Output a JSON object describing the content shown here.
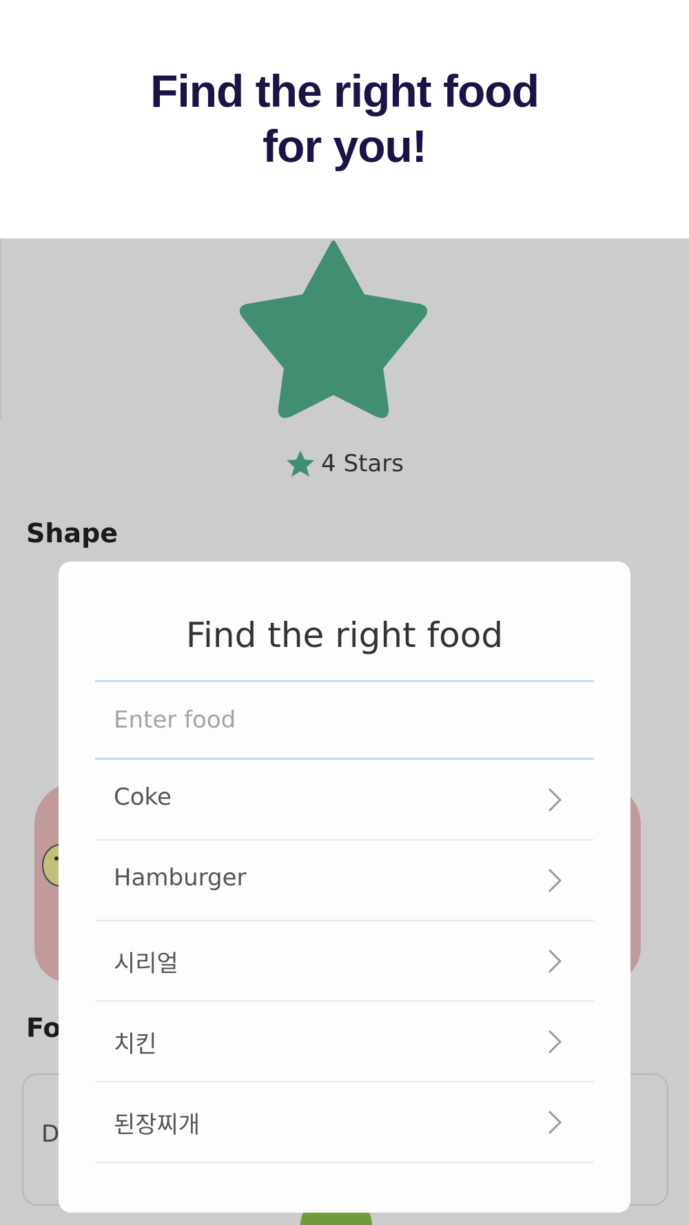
{
  "header": {
    "title_line1": "Find the right food",
    "title_line2": "for you!"
  },
  "rating": {
    "label": "4 Stars",
    "value": 4,
    "icon": "star-icon",
    "color": "#52b28c"
  },
  "sections": {
    "shape_title": "Shape",
    "food_title_partial": "Fo",
    "food_card_label_partial": "D"
  },
  "modal": {
    "title": "Find the right food",
    "search_placeholder": "Enter food",
    "items": [
      {
        "label": "Coke"
      },
      {
        "label": "Hamburger"
      },
      {
        "label": "시리얼"
      },
      {
        "label": "치킨"
      },
      {
        "label": "된장찌개"
      }
    ],
    "chevron_icon": "chevron-right-icon"
  },
  "colors": {
    "headline": "#1a1446",
    "accent": "#52b28c",
    "input_border": "#c5daf5"
  }
}
